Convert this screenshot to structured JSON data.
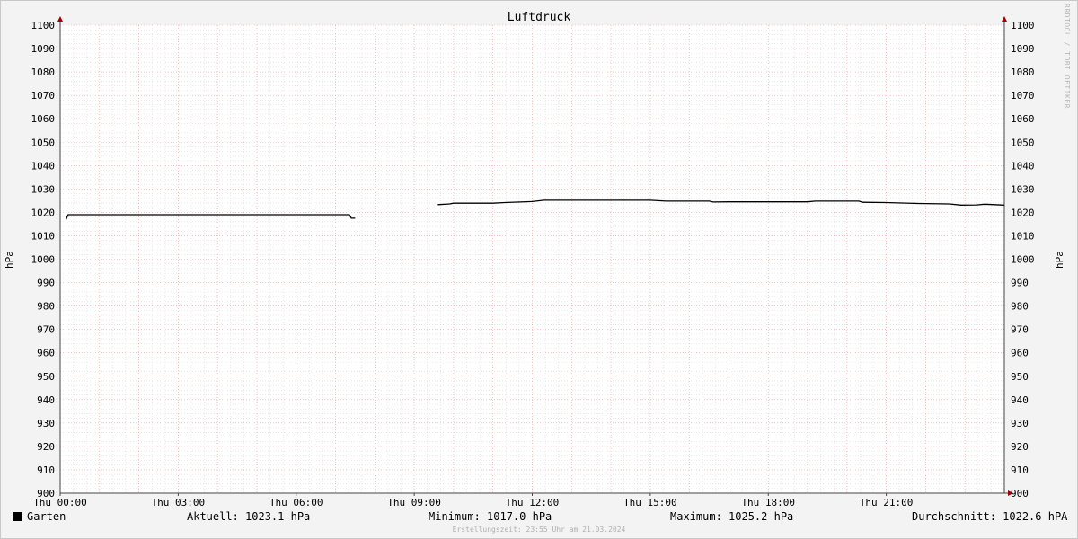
{
  "chart_data": {
    "type": "line",
    "title": "Luftdruck",
    "ylabel": "hPa",
    "ylim": [
      900,
      1100
    ],
    "y_ticks": [
      900,
      910,
      920,
      930,
      940,
      950,
      960,
      970,
      980,
      990,
      1000,
      1010,
      1020,
      1030,
      1040,
      1050,
      1060,
      1070,
      1080,
      1090,
      1100
    ],
    "x_range_hours": [
      0,
      24
    ],
    "x_ticks": [
      {
        "label": "Thu 00:00",
        "hour": 0
      },
      {
        "label": "Thu 03:00",
        "hour": 3
      },
      {
        "label": "Thu 06:00",
        "hour": 6
      },
      {
        "label": "Thu 09:00",
        "hour": 9
      },
      {
        "label": "Thu 12:00",
        "hour": 12
      },
      {
        "label": "Thu 15:00",
        "hour": 15
      },
      {
        "label": "Thu 18:00",
        "hour": 18
      },
      {
        "label": "Thu 21:00",
        "hour": 21
      }
    ],
    "grid": true,
    "series": [
      {
        "name": "Garten",
        "color": "#000000",
        "segments": [
          [
            [
              0.15,
              1017.0
            ],
            [
              0.2,
              1019.0
            ],
            [
              3.0,
              1019.0
            ],
            [
              6.0,
              1019.0
            ],
            [
              7.35,
              1019.0
            ],
            [
              7.4,
              1017.5
            ],
            [
              7.5,
              1017.5
            ]
          ],
          [
            [
              9.6,
              1023.3
            ],
            [
              9.9,
              1023.6
            ],
            [
              10.0,
              1023.9
            ],
            [
              11.0,
              1023.9
            ],
            [
              11.3,
              1024.2
            ],
            [
              12.0,
              1024.6
            ],
            [
              12.3,
              1025.2
            ],
            [
              14.0,
              1025.2
            ],
            [
              15.0,
              1025.2
            ],
            [
              15.4,
              1024.8
            ],
            [
              16.5,
              1024.8
            ],
            [
              16.6,
              1024.4
            ],
            [
              17.0,
              1024.5
            ],
            [
              19.0,
              1024.5
            ],
            [
              19.2,
              1024.8
            ],
            [
              20.3,
              1024.8
            ],
            [
              20.4,
              1024.3
            ],
            [
              21.0,
              1024.2
            ],
            [
              21.8,
              1023.8
            ],
            [
              22.6,
              1023.6
            ],
            [
              22.9,
              1023.1
            ],
            [
              23.3,
              1023.2
            ],
            [
              23.5,
              1023.5
            ],
            [
              24.0,
              1023.1
            ]
          ]
        ]
      }
    ]
  },
  "legend": {
    "series_name": "Garten",
    "current": "Aktuell: 1023.1 hPa",
    "minimum": "Minimum: 1017.0 hPa",
    "maximum": "Maximum: 1025.2 hPa",
    "average": "Durchschnitt: 1022.6 hPA"
  },
  "footer": "Erstellungszeit: 23:55 Uhr am 21.03.2024",
  "watermark": "RRDTOOL / TOBI OETIKER"
}
